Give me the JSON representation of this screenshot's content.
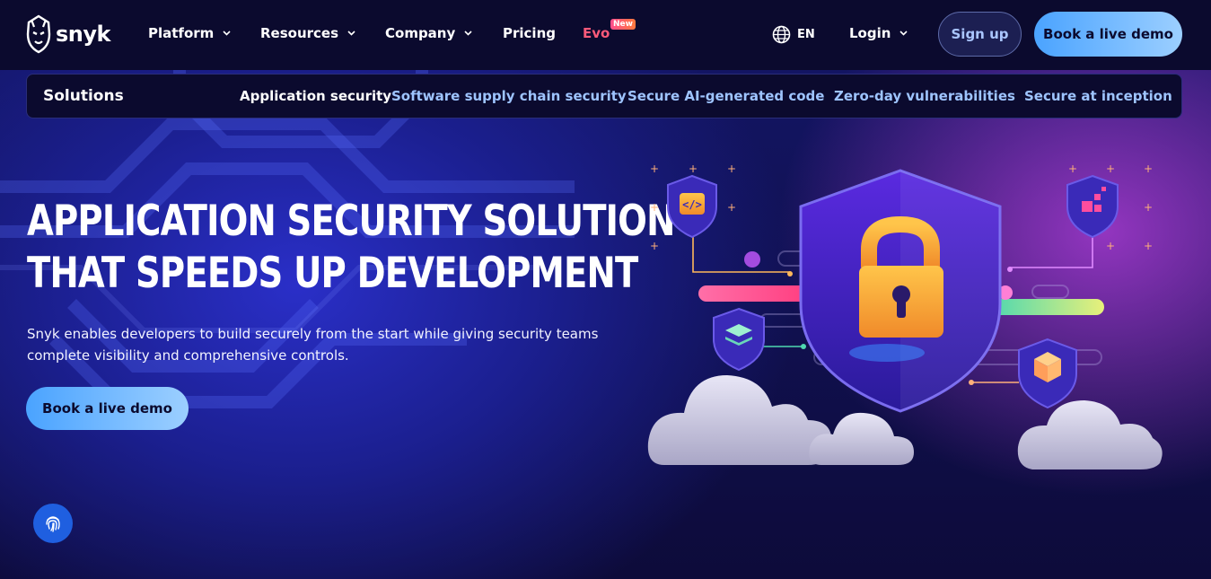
{
  "brand": {
    "name": "snyk"
  },
  "nav": {
    "items": [
      {
        "label": "Platform",
        "dropdown": true
      },
      {
        "label": "Resources",
        "dropdown": true
      },
      {
        "label": "Company",
        "dropdown": true
      },
      {
        "label": "Pricing",
        "dropdown": false
      },
      {
        "label": "Evo",
        "dropdown": false,
        "badge": "New"
      }
    ],
    "language": "EN",
    "login": "Login",
    "signup": "Sign up",
    "book_demo": "Book a live demo"
  },
  "solutions": {
    "title": "Solutions",
    "links": [
      "Application security",
      "Software supply chain security",
      "Secure AI-generated code",
      "Zero-day vulnerabilities",
      "Secure at inception"
    ],
    "active_index": 0
  },
  "hero": {
    "headline_line1": "APPLICATION SECURITY SOLUTION",
    "headline_line2": "THAT SPEEDS UP DEVELOPMENT",
    "subtext": "Snyk enables developers to build securely from the start while giving security teams complete visibility and comprehensive controls.",
    "cta": "Book a live demo"
  },
  "colors": {
    "nav_bg": "#0b0a2e",
    "accent_blue": "#4aa3ff",
    "link_blue": "#9ec4ff",
    "evo_pink": "#ff5a7a",
    "purple_glow": "#aa3cd2"
  },
  "icons": [
    "snyk-logo-icon",
    "chevron-down-icon",
    "globe-icon",
    "fingerprint-icon",
    "shield-lock-icon",
    "code-icon",
    "layers-icon",
    "cube-icon",
    "cloud-icon"
  ]
}
